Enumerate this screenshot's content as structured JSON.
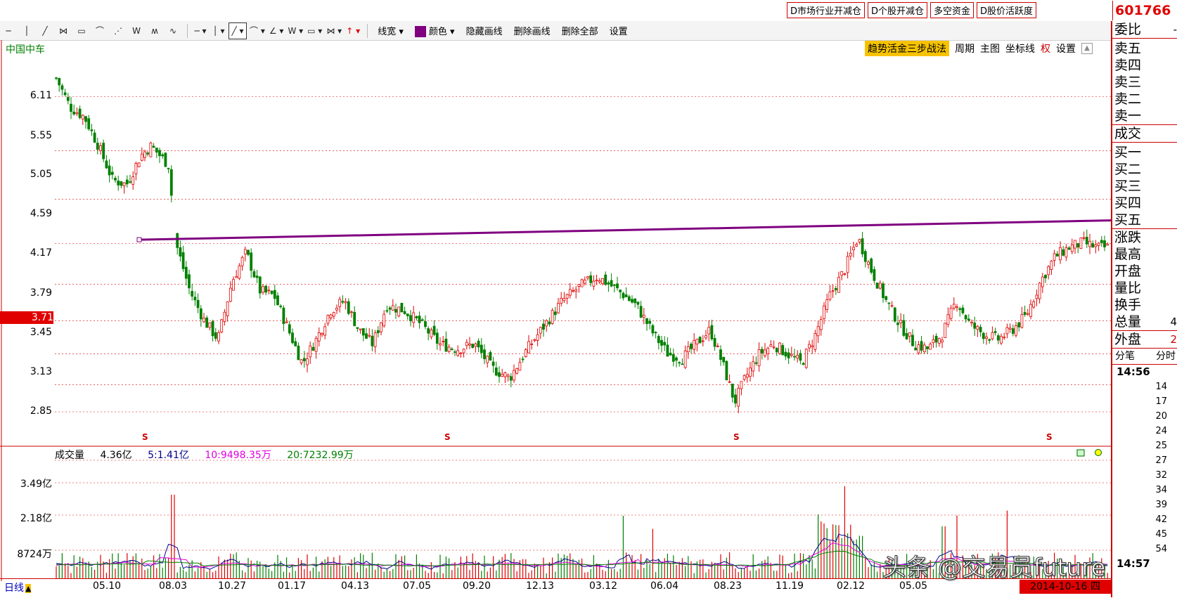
{
  "top_buttons": [
    "D市场行业开减仓",
    "D个股开减仓",
    "多空资金",
    "D股价活跃度"
  ],
  "stock_code": "601766",
  "toolbar": {
    "labels": [
      "线宽",
      "颜色",
      "隐藏画线",
      "删除画线",
      "删除全部",
      "设置"
    ],
    "line_color": "#800080"
  },
  "chart": {
    "stock_name": "中国中车",
    "menu": {
      "badge": "趋势活金三步战法",
      "items": [
        "周期",
        "主图",
        "坐标线"
      ],
      "right_item": "权",
      "settings": "设置"
    },
    "y_labels": [
      "6.11",
      "5.55",
      "5.05",
      "4.59",
      "4.17",
      "3.79",
      "3.45",
      "3.13",
      "2.85"
    ],
    "current_price": "3.71",
    "s_marker": "S"
  },
  "volume": {
    "name": "成交量",
    "value": "4.36亿",
    "ma5": "5:1.41亿",
    "ma10": "10:9498.35万",
    "ma20": "20:7232.99万",
    "y_labels": [
      "3.49亿",
      "2.18亿",
      "8724万"
    ],
    "colors": {
      "ma5": "#00008b",
      "ma10": "#e000e0",
      "ma20": "#008000"
    }
  },
  "x_axis": {
    "labels": [
      "05.10",
      "08.03",
      "10.27",
      "01.17",
      "04.13",
      "07.05",
      "09.20",
      "12.13",
      "03.12",
      "06.04",
      "08.23",
      "11.19",
      "02.12",
      "05.05"
    ],
    "period_label": "日线",
    "current_date": "2014-10-16 四"
  },
  "sidebar": {
    "top": "委比",
    "asks": [
      "卖五",
      "卖四",
      "卖三",
      "卖二",
      "卖一"
    ],
    "deal": "成交",
    "bids": [
      "买一",
      "买二",
      "买三",
      "买四",
      "买五"
    ],
    "stats": [
      {
        "label": "涨跌",
        "value": ""
      },
      {
        "label": "最高",
        "value": ""
      },
      {
        "label": "开盘",
        "value": ""
      },
      {
        "label": "量比",
        "value": ""
      },
      {
        "label": "换手",
        "value": ""
      },
      {
        "label": "总量",
        "value": "4"
      }
    ],
    "outer": {
      "label": "外盘",
      "value": "2"
    },
    "tabs": [
      "分笔",
      "分时"
    ],
    "time_head": "14:56",
    "ticks": [
      "14",
      "17",
      "20",
      "24",
      "25",
      "27",
      "32",
      "34",
      "39",
      "42",
      "45",
      "54"
    ],
    "time_foot": "14:57"
  },
  "colors": {
    "up": "#e00000",
    "down": "#008000",
    "trendline": "#800080",
    "grid": "#e00000"
  },
  "watermark": "头条 @交易员future"
}
